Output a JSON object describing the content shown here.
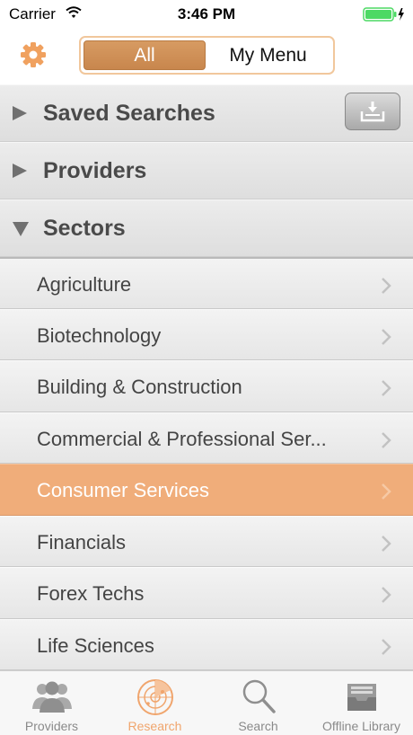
{
  "status_bar": {
    "carrier": "Carrier",
    "time": "3:46 PM"
  },
  "header": {
    "segments": [
      {
        "label": "All",
        "selected": true
      },
      {
        "label": "My Menu",
        "selected": false
      }
    ]
  },
  "sections": {
    "saved_searches": "Saved Searches",
    "providers": "Providers",
    "sectors": "Sectors"
  },
  "sector_items": [
    "Agriculture",
    "Biotechnology",
    "Building & Construction",
    "Commercial & Professional Ser...",
    "Consumer Services",
    "Financials",
    "Forex Techs",
    "Life Sciences"
  ],
  "selected_sector": "Consumer Services",
  "tabbar": [
    {
      "label": "Providers",
      "icon": "people-icon",
      "active": false
    },
    {
      "label": "Research",
      "icon": "radar-icon",
      "active": true
    },
    {
      "label": "Search",
      "icon": "magnifier-icon",
      "active": false
    },
    {
      "label": "Offline Library",
      "icon": "inbox-tray-icon",
      "active": false
    }
  ],
  "colors": {
    "accent": "#f0ad7a",
    "segment_selected": "#c8864d",
    "tab_active": "#f0a56d"
  }
}
